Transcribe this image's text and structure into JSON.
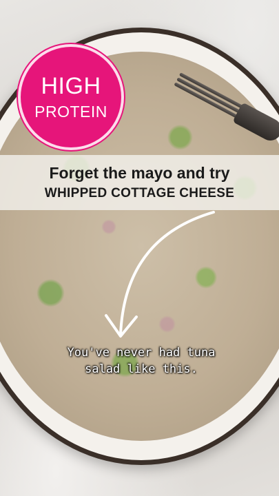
{
  "badge": {
    "line1": "HIGH",
    "line2": "PROTEIN",
    "color": "#e6157a"
  },
  "banner": {
    "line1": "Forget the mayo and try",
    "line2": "WHIPPED COTTAGE CHEESE"
  },
  "caption": {
    "line1": "You've never had tuna",
    "line2": "salad like this."
  },
  "arrow": {
    "icon": "curved-arrow-down-icon",
    "color": "#ffffff"
  }
}
